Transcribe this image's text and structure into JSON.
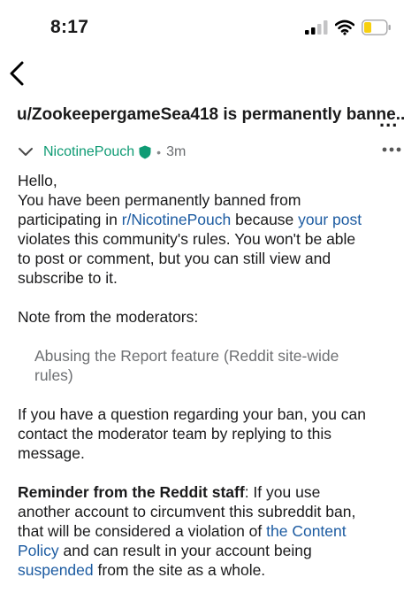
{
  "status_bar": {
    "time": "8:17"
  },
  "header": {
    "title": "u/ZookeepergameSea418 is permanently banne...",
    "more": "..."
  },
  "message": {
    "sender": "NicotinePouch",
    "separator": "•",
    "age": "3m",
    "greeting": "Hello,",
    "p1_a": "You have been permanently banned from",
    "p1_b": "participating in ",
    "p1_link1": "r/NicotinePouch",
    "p1_c": " because ",
    "p1_link2": "your post",
    "p1_d": "violates this community's rules. You won't be able",
    "p1_e": "to post or comment, but you can still view and",
    "p1_f": "subscribe to it.",
    "note_label": "Note from the moderators:",
    "note_1": "Abusing the Report feature (Reddit site-wide",
    "note_2": "rules)",
    "p3_a": "If you have a question regarding your ban, you can",
    "p3_b": "contact the moderator team by replying to this",
    "p3_c": "message.",
    "p4_bold": "Reminder from the Reddit staff",
    "p4_a": ": If you use",
    "p4_b": "another account to circumvent this subreddit ban,",
    "p4_c": "that will be considered a violation of ",
    "p4_link1": "the Content",
    "p4_link2": "Policy",
    "p4_d": " and can result in your account being",
    "p4_link3": "suspended",
    "p4_e": " from the site as a whole."
  },
  "colors": {
    "link": "#1c5ba1",
    "sender": "#0f9b74",
    "quote": "#6d6f72",
    "battery_fill": "#f7d00f"
  }
}
